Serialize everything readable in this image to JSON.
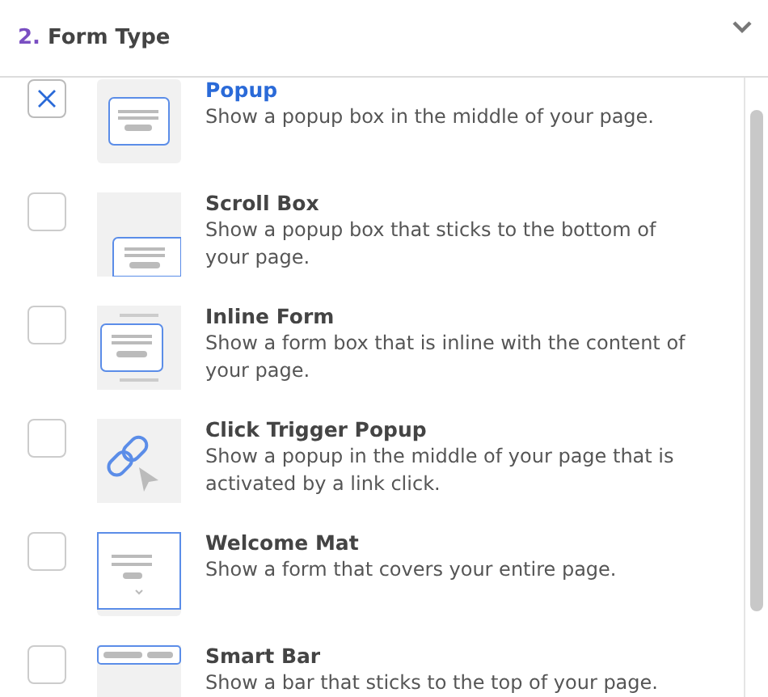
{
  "header": {
    "step": "2.",
    "title": "Form Type",
    "expanded": true
  },
  "form_types": [
    {
      "kind": "popup",
      "title": "Popup",
      "description": "Show a popup box in the middle of your page.",
      "selected": true
    },
    {
      "kind": "scroll",
      "title": "Scroll Box",
      "description": "Show a popup box that sticks to the bottom of your page.",
      "selected": false
    },
    {
      "kind": "inline",
      "title": "Inline Form",
      "description": "Show a form box that is inline with the content of your page.",
      "selected": false
    },
    {
      "kind": "link",
      "title": "Click Trigger Popup",
      "description": "Show a popup in the middle of your page that is activated by a link click.",
      "selected": false
    },
    {
      "kind": "mat",
      "title": "Welcome Mat",
      "description": "Show a form that covers your entire page.",
      "selected": false
    },
    {
      "kind": "bar",
      "title": "Smart Bar",
      "description": "Show a bar that sticks to the top of your page.",
      "selected": false
    }
  ]
}
